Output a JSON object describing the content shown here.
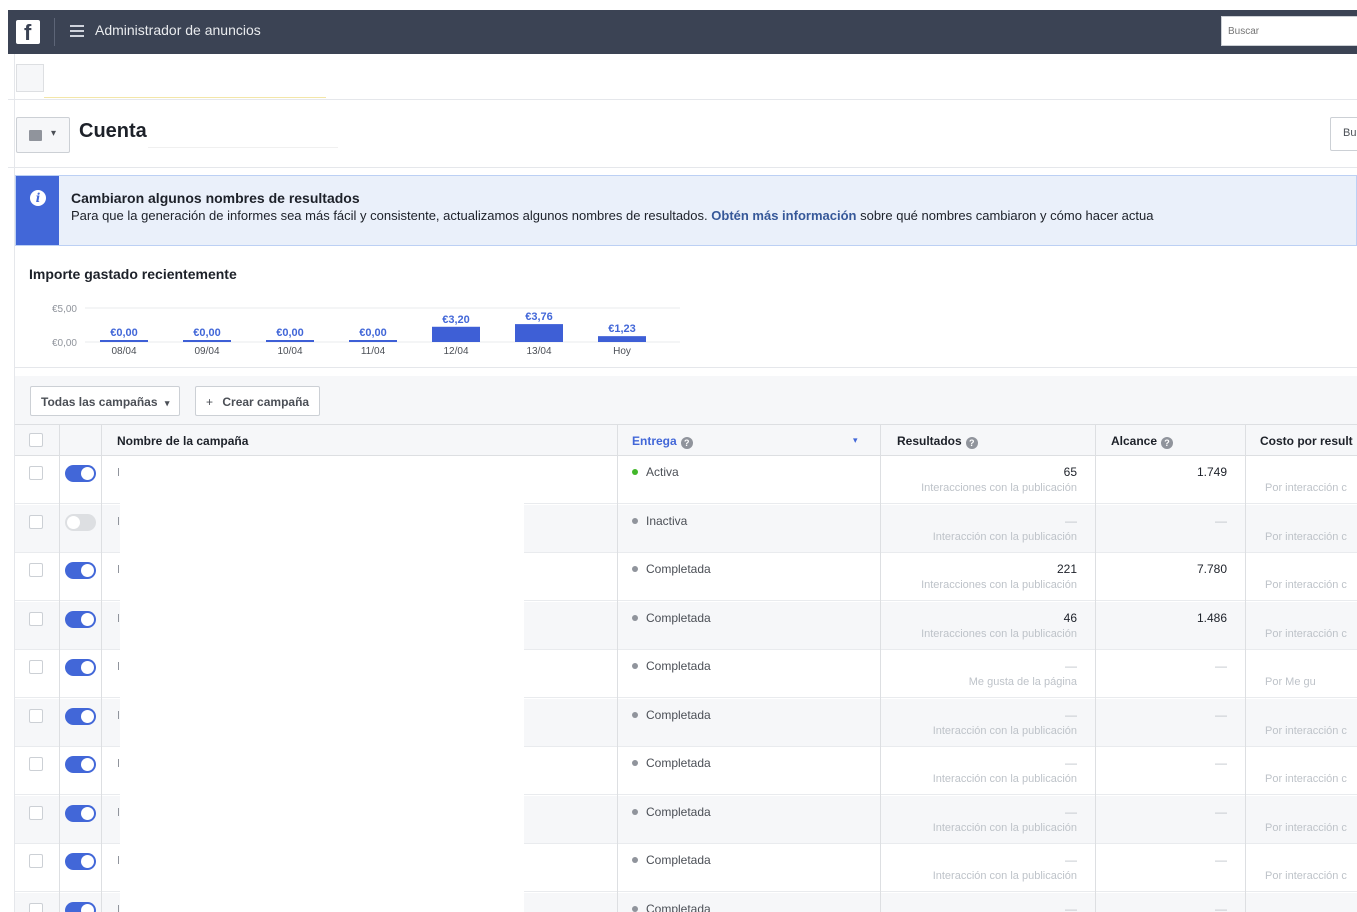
{
  "topbar": {
    "logo": "f",
    "title": "Administrador de anuncios",
    "search_placeholder": "Buscar"
  },
  "account": {
    "title": "Cuenta",
    "right_button": "Bu"
  },
  "banner": {
    "title": "Cambiaron algunos nombres de resultados",
    "text_before": "Para que la generación de informes sea más fácil y consistente, actualizamos algunos nombres de resultados.",
    "link": "Obtén más información",
    "text_after": "sobre qué nombres cambiaron y cómo hacer actua"
  },
  "spend": {
    "title": "Importe gastado recientemente",
    "chart_data": {
      "type": "bar",
      "categories": [
        "08/04",
        "09/04",
        "10/04",
        "11/04",
        "12/04",
        "13/04",
        "Hoy"
      ],
      "values": [
        0.0,
        0.0,
        0.0,
        0.0,
        3.2,
        3.76,
        1.23
      ],
      "value_labels": [
        "€0,00",
        "€0,00",
        "€0,00",
        "€0,00",
        "€3,20",
        "€3,76",
        "€1,23"
      ],
      "y_ticks": [
        "€5,00",
        "€0,00"
      ],
      "ylim": [
        0,
        5
      ],
      "color": "#3e5fd6"
    }
  },
  "toolbar": {
    "campaigns_filter": "Todas las campañas",
    "create_campaign": "Crear campaña"
  },
  "table": {
    "headers": {
      "name": "Nombre de la campaña",
      "delivery": "Entrega",
      "results": "Resultados",
      "reach": "Alcance",
      "cost": "Costo por result"
    },
    "rows": [
      {
        "on": true,
        "status": "Activa",
        "status_color": "green",
        "results": "65",
        "results_sub": "Interacciones con la publicación",
        "reach": "1.749",
        "cost_sub": "Por interacción c"
      },
      {
        "on": false,
        "status": "Inactiva",
        "status_color": "grey",
        "results": "—",
        "results_sub": "Interacción con la publicación",
        "reach": "—",
        "cost_sub": "Por interacción c"
      },
      {
        "on": true,
        "status": "Completada",
        "status_color": "grey",
        "results": "221",
        "results_sub": "Interacciones con la publicación",
        "reach": "7.780",
        "cost_sub": "Por interacción c"
      },
      {
        "on": true,
        "status": "Completada",
        "status_color": "grey",
        "results": "46",
        "results_sub": "Interacciones con la publicación",
        "reach": "1.486",
        "cost_sub": "Por interacción c"
      },
      {
        "on": true,
        "status": "Completada",
        "status_color": "grey",
        "results": "—",
        "results_sub": "Me gusta de la página",
        "reach": "—",
        "cost_sub": "Por Me gu"
      },
      {
        "on": true,
        "status": "Completada",
        "status_color": "grey",
        "results": "—",
        "results_sub": "Interacción con la publicación",
        "reach": "—",
        "cost_sub": "Por interacción c"
      },
      {
        "on": true,
        "status": "Completada",
        "status_color": "grey",
        "results": "—",
        "results_sub": "Interacción con la publicación",
        "reach": "—",
        "cost_sub": "Por interacción c"
      },
      {
        "on": true,
        "status": "Completada",
        "status_color": "grey",
        "results": "—",
        "results_sub": "Interacción con la publicación",
        "reach": "—",
        "cost_sub": "Por interacción c"
      },
      {
        "on": true,
        "status": "Completada",
        "status_color": "grey",
        "results": "—",
        "results_sub": "Interacción con la publicación",
        "reach": "—",
        "cost_sub": "Por interacción c"
      },
      {
        "on": true,
        "status": "Completada",
        "status_color": "grey",
        "results": "—",
        "results_sub": "",
        "reach": "—",
        "cost_sub": ""
      }
    ]
  }
}
